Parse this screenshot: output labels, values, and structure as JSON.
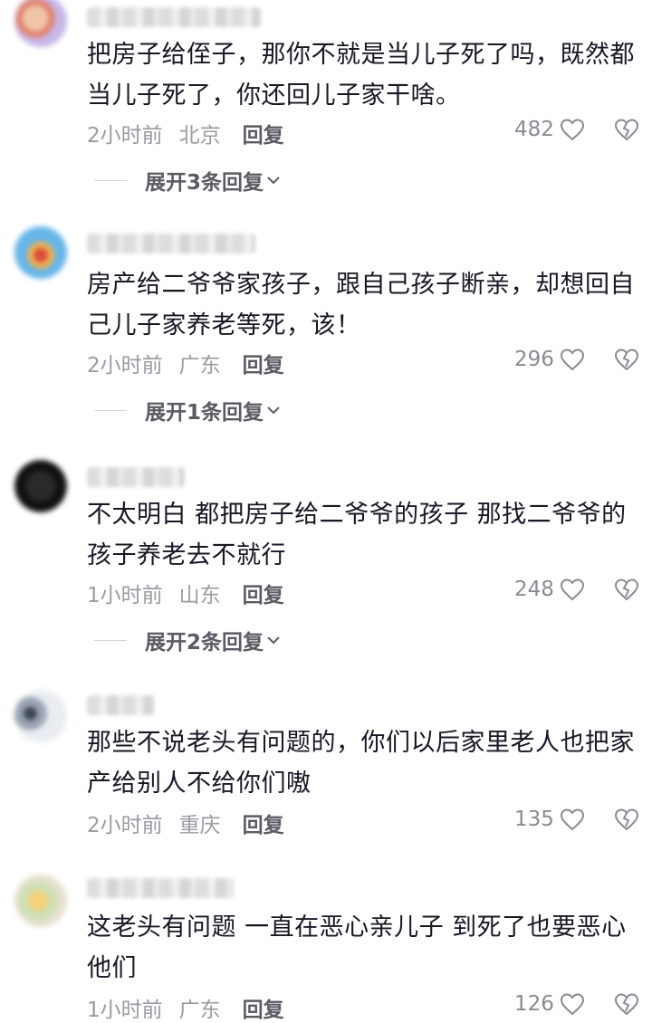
{
  "comments": [
    {
      "text": "把房子给侄子，那你不就是当儿子死了吗，既然都当儿子死了，你还回儿子家干啥。",
      "time": "2小时前",
      "location": "北京",
      "reply_label": "回复",
      "likes": "482",
      "expand_label": "展开3条回复",
      "avatar_colors": [
        "#c7b7e8",
        "#f1c6a8",
        "#e27f6d"
      ]
    },
    {
      "text": "房产给二爷爷家孩子，跟自己孩子断亲，却想回自己儿子家养老等死，该！",
      "time": "2小时前",
      "location": "广东",
      "reply_label": "回复",
      "likes": "296",
      "expand_label": "展开1条回复",
      "avatar_colors": [
        "#67b6e8",
        "#f0b24a",
        "#d84a3c"
      ]
    },
    {
      "text": "不太明白 都把房子给二爷爷的孩子 那找二爷爷的孩子养老去不就行",
      "time": "1小时前",
      "location": "山东",
      "reply_label": "回复",
      "likes": "248",
      "expand_label": "展开2条回复",
      "avatar_colors": [
        "#111111",
        "#2a2a2a",
        "#d8d8d8"
      ]
    },
    {
      "text": "那些不说老头有问题的，你们以后家里老人也把家产给别人不给你们嗷",
      "time": "2小时前",
      "location": "重庆",
      "reply_label": "回复",
      "likes": "135",
      "expand_label": "",
      "avatar_colors": [
        "#e9edf2",
        "#9aa4b2",
        "#3a4452"
      ]
    },
    {
      "text": "这老头有问题 一直在恶心亲儿子 到死了也要恶心他们",
      "time": "1小时前",
      "location": "广东",
      "reply_label": "回复",
      "likes": "126",
      "expand_label": "",
      "avatar_colors": [
        "#cde0b6",
        "#f3d27a",
        "#e8e0d0"
      ]
    }
  ],
  "icons": {
    "like": "heart-outline-icon",
    "dislike": "broken-heart-icon",
    "expand": "chevron-down-icon"
  }
}
